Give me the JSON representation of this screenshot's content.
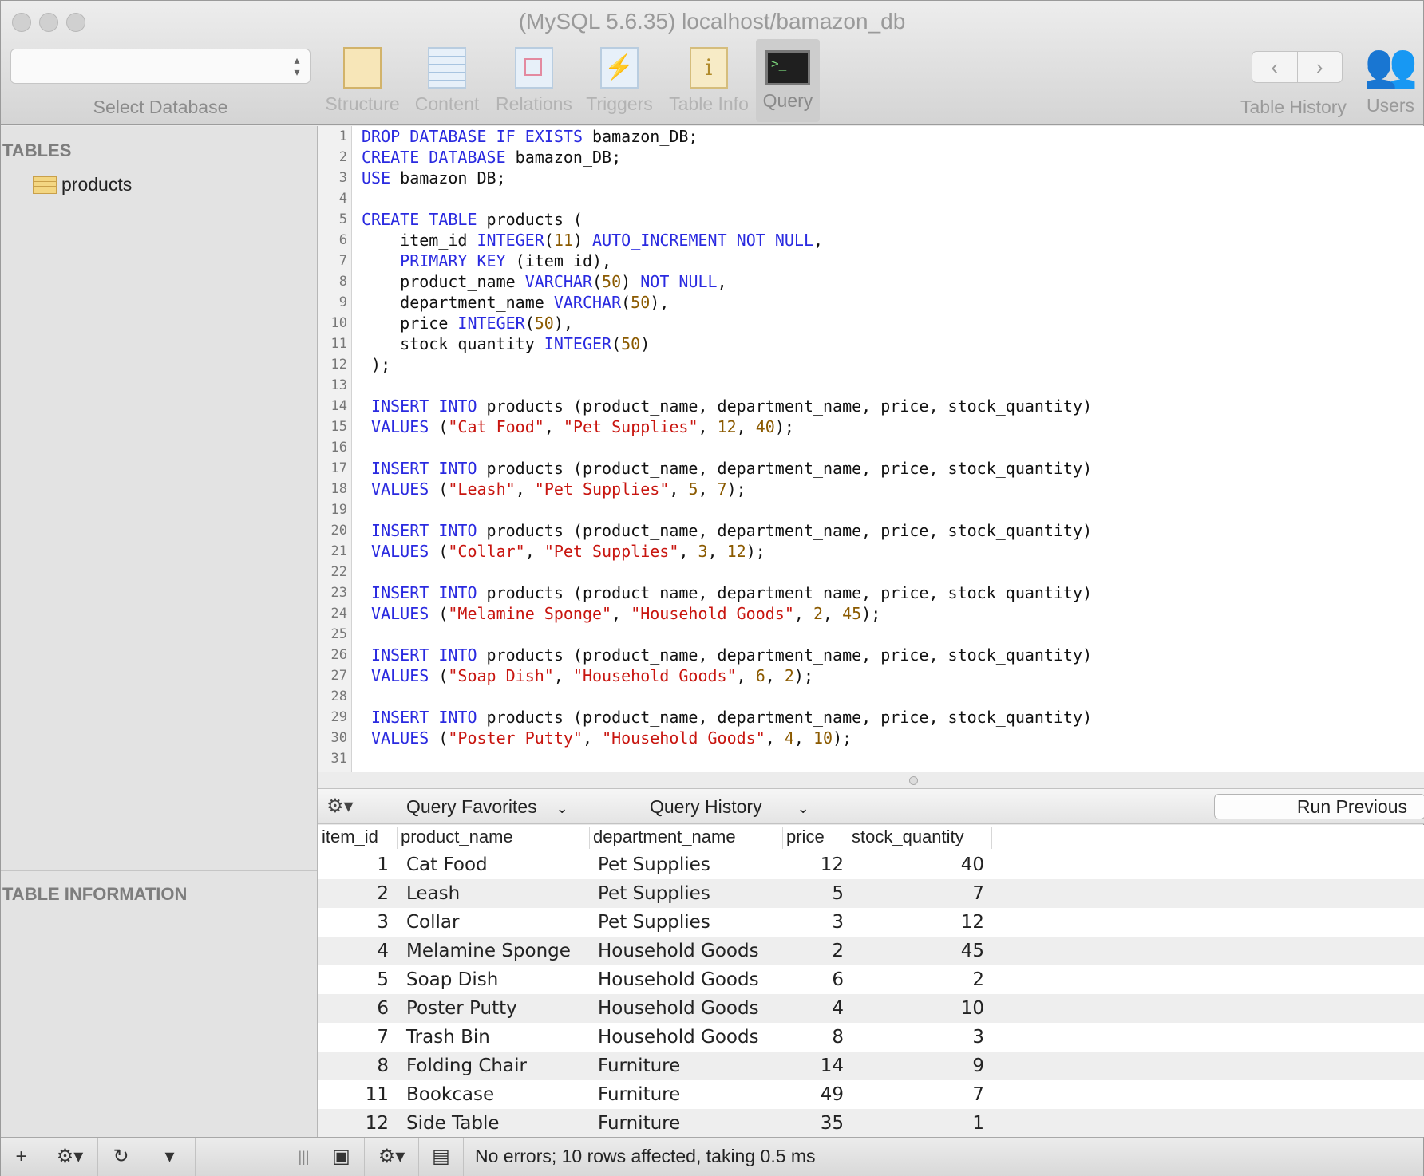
{
  "window": {
    "title": "(MySQL 5.6.35) localhost/bamazon_db"
  },
  "toolbar": {
    "select_database_label": "Select Database",
    "buttons": [
      "Structure",
      "Content",
      "Relations",
      "Triggers",
      "Table Info",
      "Query"
    ],
    "active": "Query",
    "table_history_label": "Table History",
    "users_label": "Users"
  },
  "sidebar": {
    "tables_heading": "TABLES",
    "tables": [
      "products"
    ],
    "info_heading": "TABLE INFORMATION"
  },
  "editor": {
    "line_numbers": [
      "1",
      "2",
      "3",
      "4",
      "5",
      "6",
      "7",
      "8",
      "9",
      "10",
      "11",
      "12",
      "13",
      "14",
      "15",
      "16",
      "17",
      "18",
      "19",
      "20",
      "21",
      "22",
      "23",
      "24",
      "25",
      "26",
      "27",
      "28",
      "29",
      "30",
      "31"
    ],
    "lines": [
      "DROP DATABASE IF EXISTS bamazon_DB;",
      "CREATE DATABASE bamazon_DB;",
      "USE bamazon_DB;",
      "",
      "CREATE TABLE products (",
      "    item_id INTEGER(11) AUTO_INCREMENT NOT NULL,",
      "    PRIMARY KEY (item_id),",
      "    product_name VARCHAR(50) NOT NULL,",
      "    department_name VARCHAR(50),",
      "    price INTEGER(50),",
      "    stock_quantity INTEGER(50)",
      " );",
      "",
      " INSERT INTO products (product_name, department_name, price, stock_quantity)",
      " VALUES (\"Cat Food\", \"Pet Supplies\", 12, 40);",
      "",
      " INSERT INTO products (product_name, department_name, price, stock_quantity)",
      " VALUES (\"Leash\", \"Pet Supplies\", 5, 7);",
      "",
      " INSERT INTO products (product_name, department_name, price, stock_quantity)",
      " VALUES (\"Collar\", \"Pet Supplies\", 3, 12);",
      "",
      " INSERT INTO products (product_name, department_name, price, stock_quantity)",
      " VALUES (\"Melamine Sponge\", \"Household Goods\", 2, 45);",
      "",
      " INSERT INTO products (product_name, department_name, price, stock_quantity)",
      " VALUES (\"Soap Dish\", \"Household Goods\", 6, 2);",
      "",
      " INSERT INTO products (product_name, department_name, price, stock_quantity)",
      " VALUES (\"Poster Putty\", \"Household Goods\", 4, 10);",
      ""
    ]
  },
  "results_bar": {
    "favorites_label": "Query Favorites",
    "history_label": "Query History",
    "run_previous_label": "Run Previous"
  },
  "results": {
    "columns": [
      "item_id",
      "product_name",
      "department_name",
      "price",
      "stock_quantity"
    ],
    "rows": [
      [
        "1",
        "Cat Food",
        "Pet Supplies",
        "12",
        "40"
      ],
      [
        "2",
        "Leash",
        "Pet Supplies",
        "5",
        "7"
      ],
      [
        "3",
        "Collar",
        "Pet Supplies",
        "3",
        "12"
      ],
      [
        "4",
        "Melamine Sponge",
        "Household Goods",
        "2",
        "45"
      ],
      [
        "5",
        "Soap Dish",
        "Household Goods",
        "6",
        "2"
      ],
      [
        "6",
        "Poster Putty",
        "Household Goods",
        "4",
        "10"
      ],
      [
        "7",
        "Trash Bin",
        "Household Goods",
        "8",
        "3"
      ],
      [
        "8",
        "Folding Chair",
        "Furniture",
        "14",
        "9"
      ],
      [
        "11",
        "Bookcase",
        "Furniture",
        "49",
        "7"
      ],
      [
        "12",
        "Side Table",
        "Furniture",
        "35",
        "1"
      ]
    ]
  },
  "status": {
    "message": "No errors; 10 rows affected, taking 0.5 ms"
  }
}
